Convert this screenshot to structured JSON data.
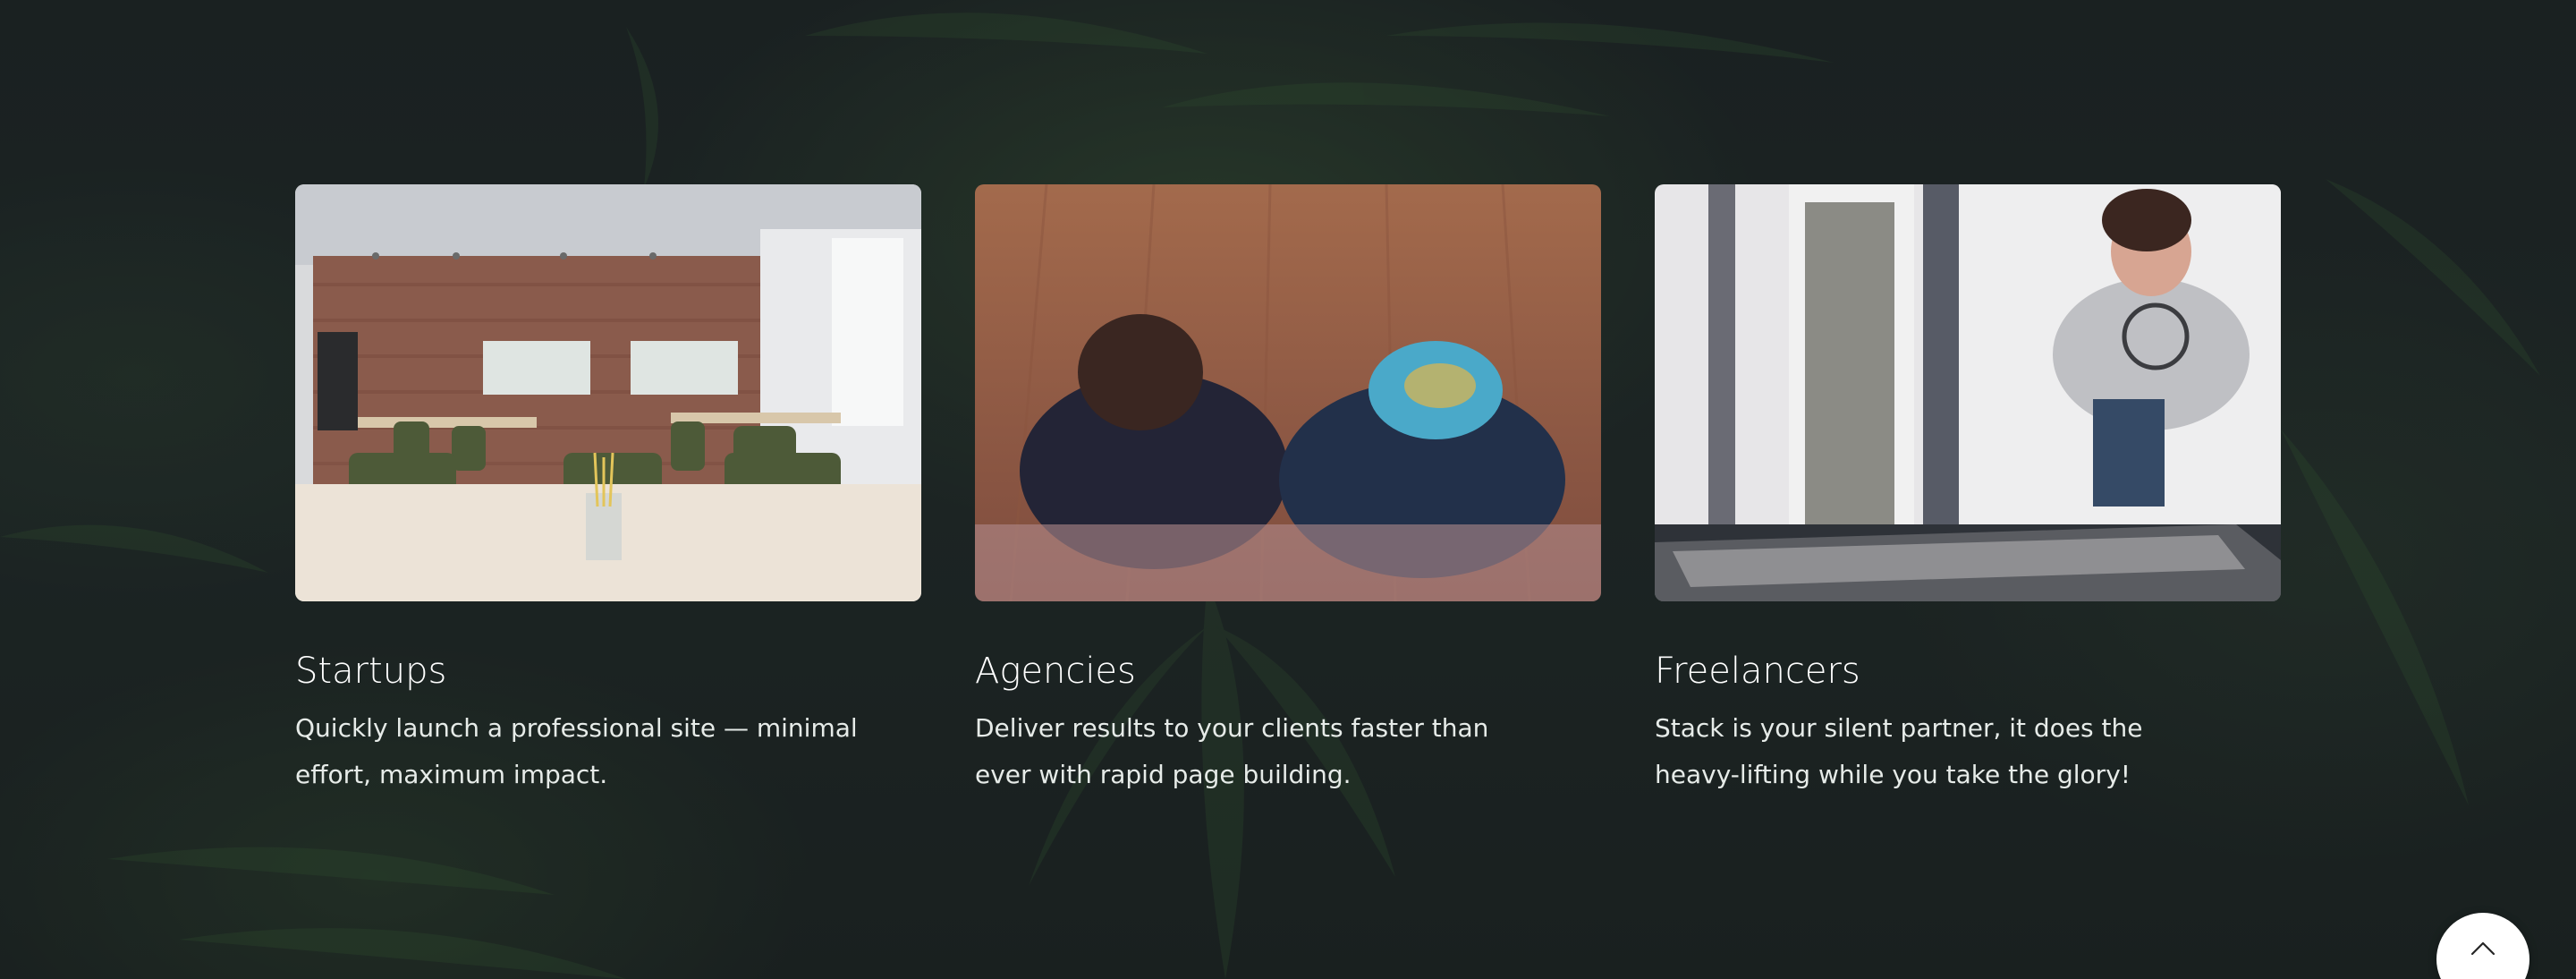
{
  "cards": [
    {
      "title": "Startups",
      "description": "Quickly launch a professional site — minimal effort, maximum impact.",
      "image": "empty-meeting-room-photo"
    },
    {
      "title": "Agencies",
      "description": "Deliver results to your clients faster than ever with rapid page building.",
      "image": "two-people-overhead-photo"
    },
    {
      "title": "Freelancers",
      "description": "Stack is your silent partner, it does the heavy-lifting while you take the glory!",
      "image": "woman-working-at-table-photo"
    }
  ],
  "back_to_top": {
    "icon": "chevron-up-icon"
  },
  "colors": {
    "background": "#1f2627",
    "text": "#ffffff",
    "button": "#ffffff"
  }
}
